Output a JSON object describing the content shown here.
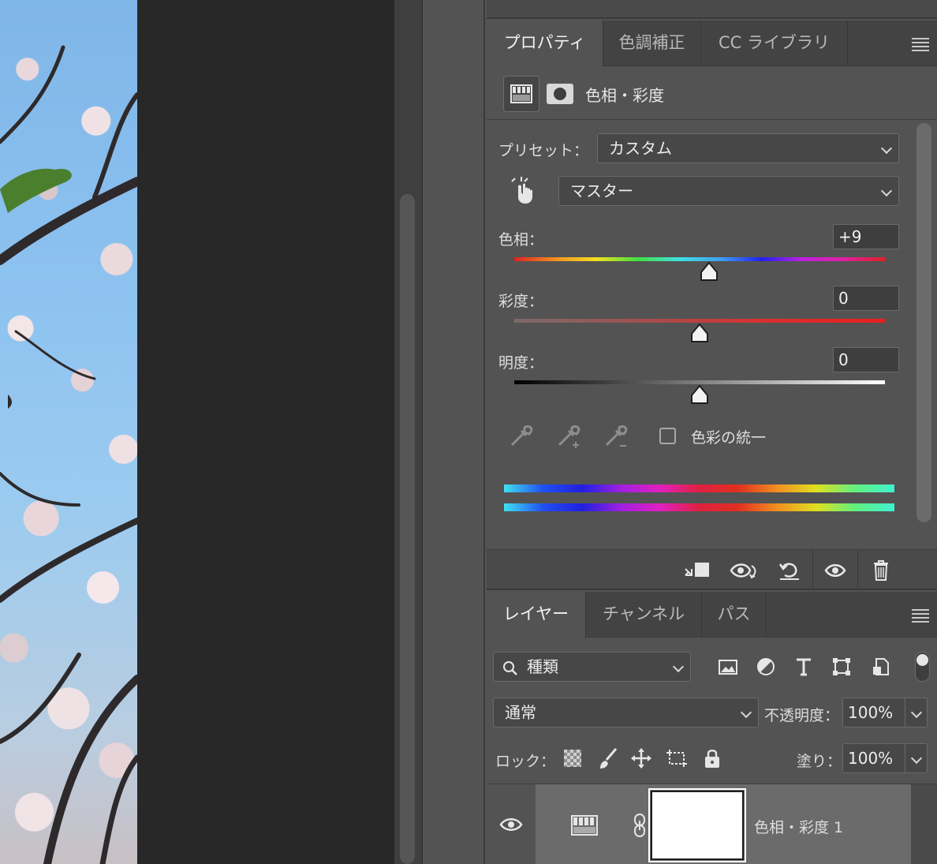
{
  "properties_panel": {
    "tabs": [
      {
        "label": "プロパティ",
        "active": true
      },
      {
        "label": "色調補正",
        "active": false
      },
      {
        "label": "CC ライブラリ",
        "active": false
      }
    ],
    "adjustment_title": "色相・彩度",
    "preset_label": "プリセット：",
    "preset_value": "カスタム",
    "channel_value": "マスター",
    "hue": {
      "label": "色相：",
      "value": "+9",
      "level": 9
    },
    "saturation": {
      "label": "彩度：",
      "value": "0",
      "level": 0
    },
    "lightness": {
      "label": "明度：",
      "value": "0",
      "level": 0
    },
    "colorize_label": "色彩の統一",
    "colorize_checked": false
  },
  "layers_panel": {
    "tabs": [
      {
        "label": "レイヤー",
        "active": true
      },
      {
        "label": "チャンネル",
        "active": false
      },
      {
        "label": "パス",
        "active": false
      }
    ],
    "filter_kind": "種類",
    "blend_mode": "通常",
    "opacity_label": "不透明度：",
    "opacity_value": "100%",
    "lock_label": "ロック：",
    "fill_label": "塗り：",
    "fill_value": "100%",
    "layer_name": "色相・彩度 1"
  },
  "colors": {
    "panel_bg": "#535353",
    "tab_bar_bg": "#434343",
    "canvas_dark": "#282828",
    "text": "#e6e6e6"
  },
  "icons": [
    "hue-saturation-adjustment-icon",
    "layer-mask-icon",
    "targeted-adjustment-hand-icon",
    "eyedropper-icon",
    "eyedropper-plus-icon",
    "eyedropper-minus-icon",
    "clip-to-layer-icon",
    "view-previous-state-icon",
    "reset-icon",
    "visibility-eye-icon",
    "trash-icon",
    "search-icon",
    "image-filter-icon",
    "adjustment-filter-icon",
    "type-filter-icon",
    "shape-filter-icon",
    "smart-object-filter-icon",
    "lock-transparency-icon",
    "lock-paint-icon",
    "lock-position-icon",
    "lock-artboard-icon",
    "lock-all-icon",
    "link-icon"
  ]
}
